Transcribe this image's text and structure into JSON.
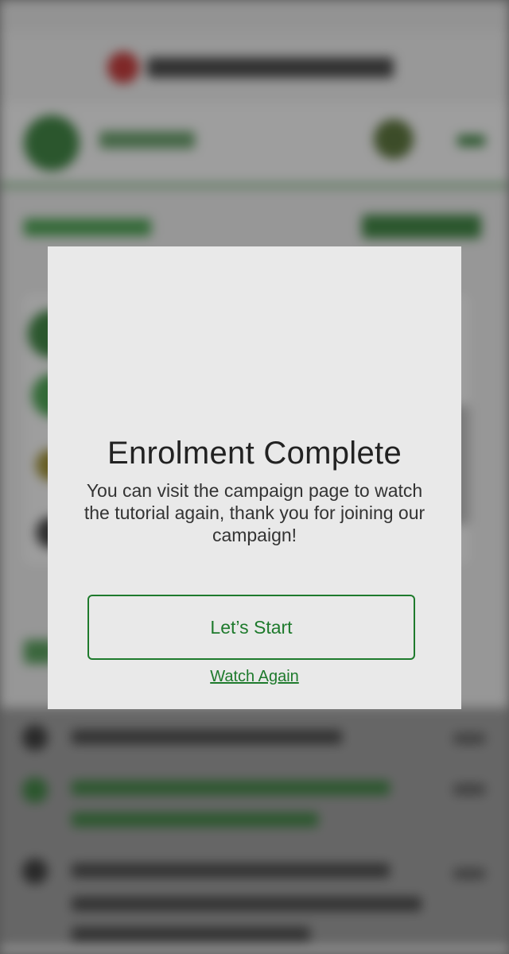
{
  "modal": {
    "title": "Enrolment Complete",
    "message": "You can visit the campaign page to watch the tutorial again, thank you for joining our campaign!",
    "primary_button_label": "Let’s Start",
    "secondary_link_label": "Watch Again",
    "icon": "check-circle-icon",
    "decoration_icon": "sparkle-icon"
  },
  "colors": {
    "accent_green": "#1e7a2c",
    "check_green_light": "#34a845",
    "check_green_dark": "#2e8b3a",
    "sparkle_yellow": "#ffcc00",
    "modal_background": "#e9e9e9"
  }
}
